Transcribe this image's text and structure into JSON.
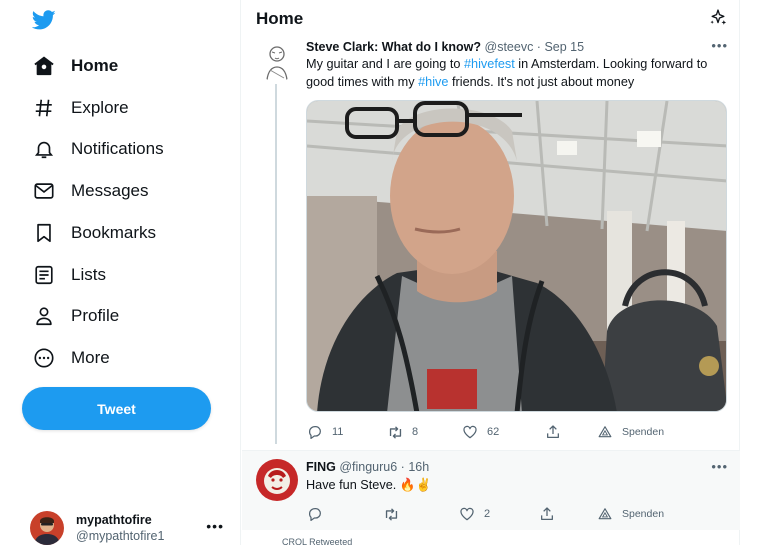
{
  "colors": {
    "accent": "#1d9bf0",
    "text": "#0f1419",
    "muted": "#536471",
    "border": "#eff3f4"
  },
  "logo_icon": "twitter-bird-icon",
  "nav": [
    {
      "label": "Home",
      "icon": "home-icon",
      "active": true
    },
    {
      "label": "Explore",
      "icon": "hashtag-icon",
      "active": false
    },
    {
      "label": "Notifications",
      "icon": "bell-icon",
      "active": false
    },
    {
      "label": "Messages",
      "icon": "envelope-icon",
      "active": false
    },
    {
      "label": "Bookmarks",
      "icon": "bookmark-icon",
      "active": false
    },
    {
      "label": "Lists",
      "icon": "list-icon",
      "active": false
    },
    {
      "label": "Profile",
      "icon": "person-icon",
      "active": false
    },
    {
      "label": "More",
      "icon": "more-circle-icon",
      "active": false
    }
  ],
  "tweet_button": "Tweet",
  "account": {
    "display_name": "mypathtofire",
    "handle": "@mypathtofire1",
    "menu": "•••"
  },
  "header": {
    "title": "Home",
    "icon": "sparkle-icon"
  },
  "tweets": [
    {
      "display_name": "Steve Clark: What do I know?",
      "meta": "@steevc · Sep 15",
      "more": "•••",
      "text": {
        "p1": "My guitar and I are going to ",
        "tag1": "#hivefest",
        "p2": " in Amsterdam. Looking forward to good times with my ",
        "tag2": "#hive",
        "p3": " friends. It's not just about money"
      },
      "actions": {
        "replies": "11",
        "retweets": "8",
        "likes": "62",
        "spenden": "Spenden"
      }
    },
    {
      "display_name": "FING",
      "meta": "@finguru6 · 16h",
      "more": "•••",
      "text": {
        "p1": "Have fun Steve. 🔥✌️"
      },
      "actions": {
        "replies": "",
        "retweets": "",
        "likes": "2",
        "spenden": "Spenden"
      }
    }
  ],
  "peek_text": "CRQL Retweeted"
}
